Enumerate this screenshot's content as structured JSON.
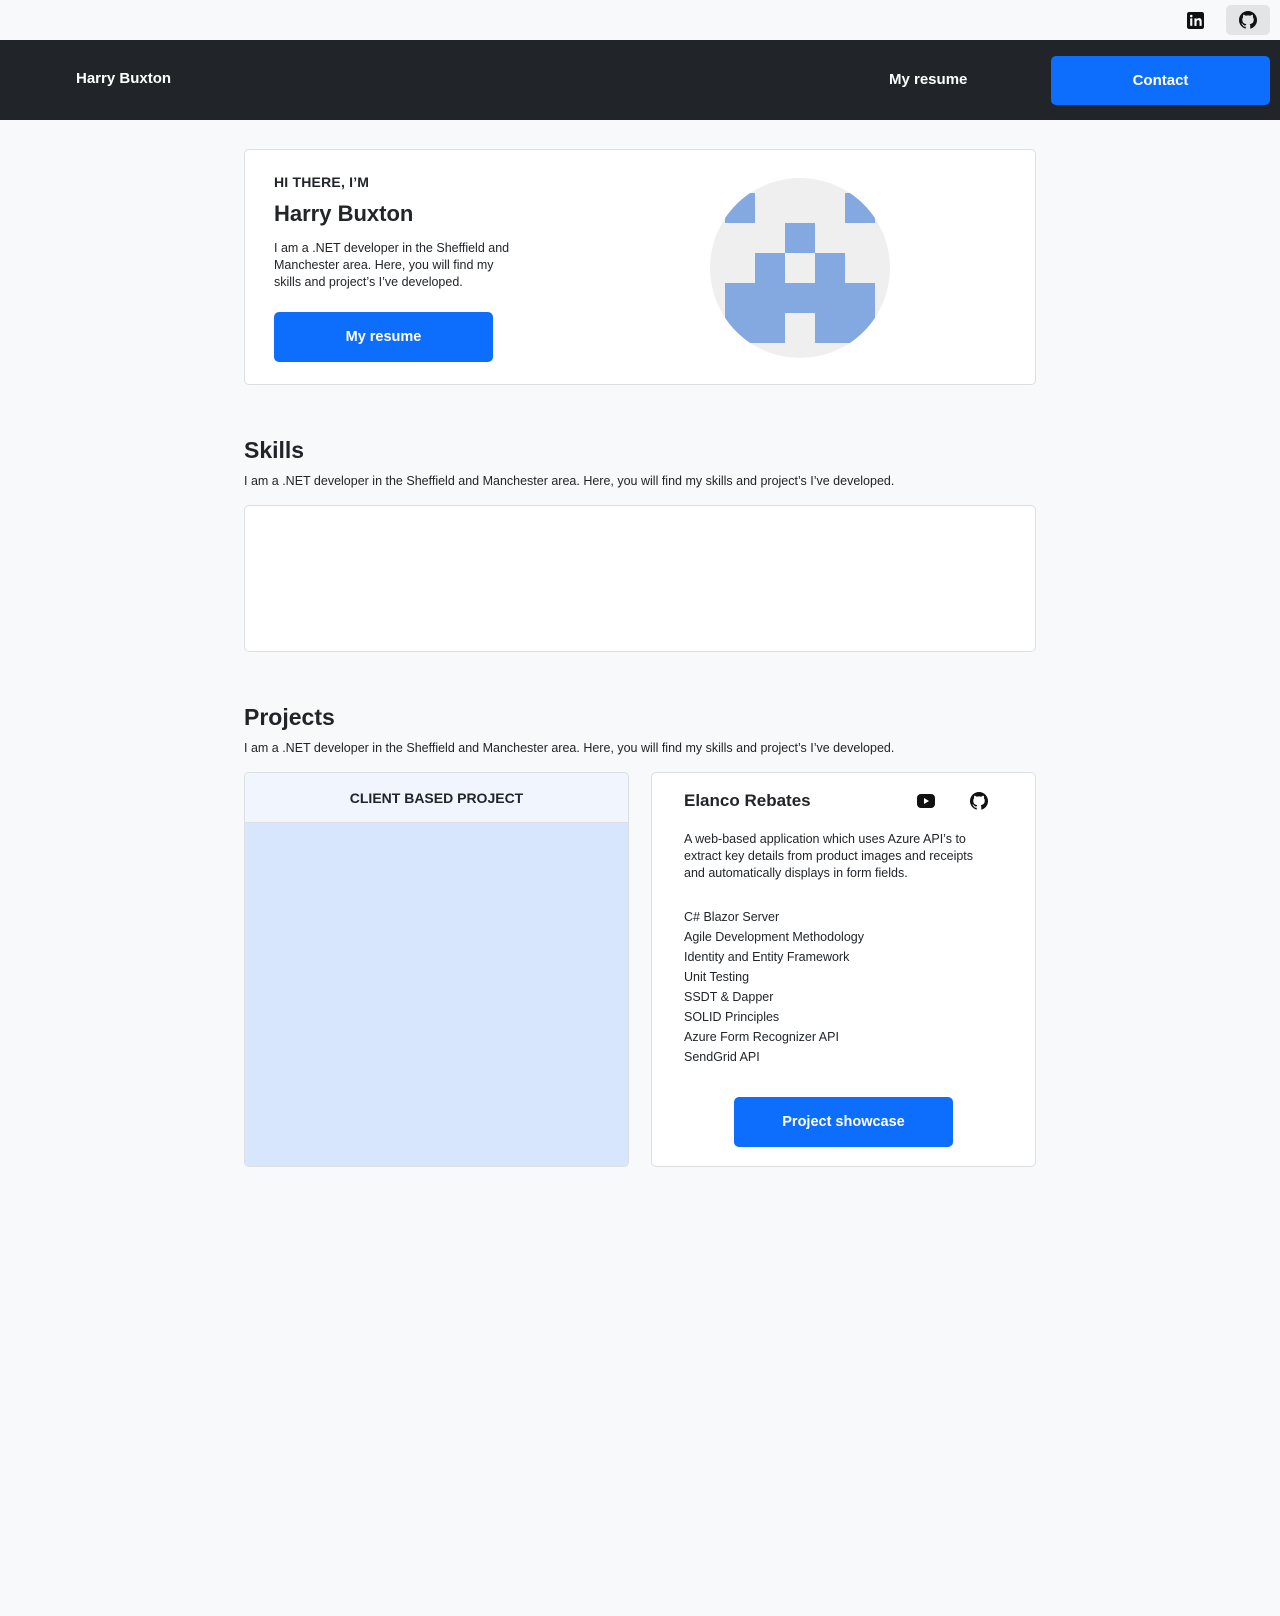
{
  "topbar": {
    "icons": [
      "linkedin-icon",
      "github-icon"
    ]
  },
  "navbar": {
    "brand": "Harry Buxton",
    "link_resume": "My resume",
    "link_contact": "Contact"
  },
  "hero": {
    "eyebrow": "HI THERE, I’M",
    "name": "Harry Buxton",
    "text": "I am a .NET developer in the Sheffield and Manchester area. Here, you will find my skills and project’s I’ve developed.",
    "button": "My resume",
    "avatar_color": "#84a9e1"
  },
  "skills": {
    "title": "Skills",
    "subtitle": "I am a .NET developer in the Sheffield and Manchester area. Here, you will find my skills and project’s I’ve developed."
  },
  "projects": {
    "title": "Projects",
    "subtitle": "I am a .NET developer in the Sheffield and Manchester area. Here, you will find my skills and project’s I’ve developed.",
    "client_card": {
      "header": "CLIENT BASED PROJECT"
    },
    "project": {
      "title": "Elanco Rebates",
      "icons": [
        "youtube-icon",
        "github-icon"
      ],
      "description": "A web-based application which uses Azure API’s to extract key details from product images and receipts and automatically displays in form fields.",
      "tech": [
        "C# Blazor Server",
        "Agile Development Methodology",
        "Identity and Entity Framework",
        "Unit Testing",
        "SSDT & Dapper",
        "SOLID Principles",
        "Azure Form Recognizer API",
        "SendGrid API"
      ],
      "button": "Project showcase"
    }
  },
  "colors": {
    "primary": "#0d6efd",
    "navbar": "#212529",
    "background": "#f8f9fa"
  }
}
